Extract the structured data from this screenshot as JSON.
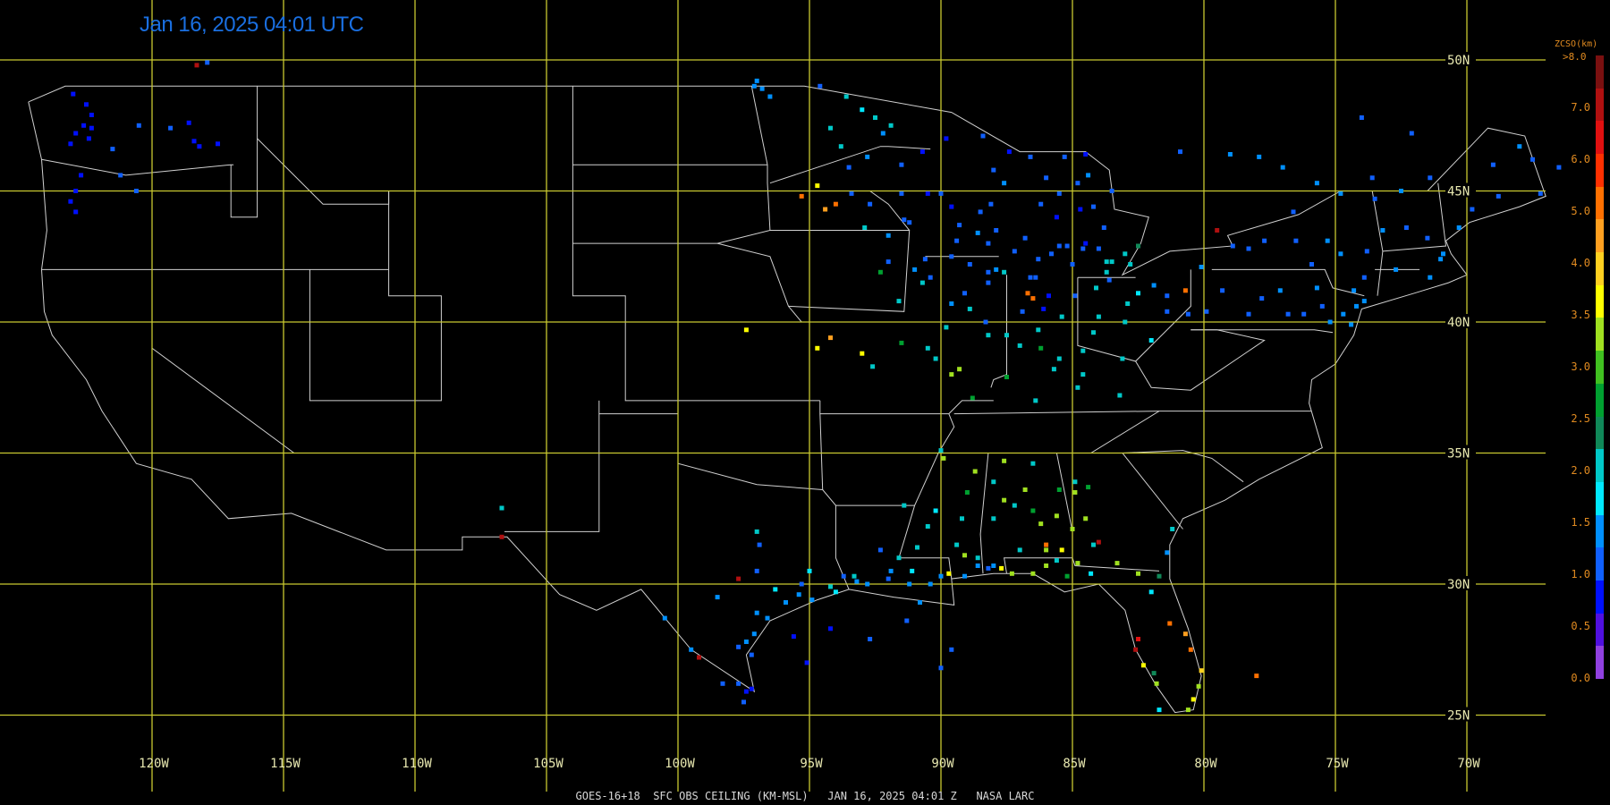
{
  "header": {
    "timestamp": "Jan 16, 2025 04:01 UTC"
  },
  "footer": {
    "caption": "GOES-16+18  SFC OBS CEILING (KM-MSL)   JAN 16, 2025 04:01 Z   NASA LARC"
  },
  "map": {
    "projection": "equirectangular",
    "lon_range": [
      -125,
      -66
    ],
    "lat_range": [
      23.5,
      52
    ],
    "lon_lines": [
      -120,
      -115,
      -110,
      -105,
      -100,
      -95,
      -90,
      -85,
      -80,
      -75,
      -70
    ],
    "lon_labels": [
      "120W",
      "115W",
      "110W",
      "105W",
      "100W",
      "95W",
      "90W",
      "85W",
      "80W",
      "75W",
      "70W"
    ],
    "lat_lines": [
      50,
      45,
      40,
      35,
      30,
      25
    ],
    "lat_labels": [
      "50N",
      "45N",
      "40N",
      "35N",
      "30N",
      "25N"
    ],
    "grid_color": "#c8c830",
    "boundary_color": "#d0d0d0"
  },
  "legend": {
    "title": "ZCSO(km)",
    "max_label": ">8.0",
    "ticks": [
      "7.0",
      "6.0",
      "5.0",
      "4.0",
      "3.5",
      "3.0",
      "2.5",
      "2.0",
      "1.5",
      "1.0",
      "0.5",
      "0.0"
    ],
    "colors": [
      "#7a1010",
      "#b01010",
      "#e01010",
      "#ff3000",
      "#ff7000",
      "#ffa020",
      "#ffd020",
      "#ffff00",
      "#a0e020",
      "#40c020",
      "#00a030",
      "#108858",
      "#00c8c8",
      "#00e8ff",
      "#0090ff",
      "#1060ff",
      "#0010ff",
      "#5010e0",
      "#9040e0"
    ]
  },
  "stations": [
    [
      -123.0,
      48.7,
      0.5
    ],
    [
      -122.5,
      48.3,
      0.5
    ],
    [
      -122.3,
      47.9,
      0.5
    ],
    [
      -122.6,
      47.5,
      0.5
    ],
    [
      -122.9,
      47.2,
      0.5
    ],
    [
      -122.4,
      47.0,
      0.5
    ],
    [
      -122.3,
      47.4,
      0.5
    ],
    [
      -123.1,
      46.8,
      0.5
    ],
    [
      -122.7,
      45.6,
      0.5
    ],
    [
      -122.9,
      45.0,
      0.5
    ],
    [
      -123.1,
      44.6,
      0.5
    ],
    [
      -122.9,
      44.2,
      0.5
    ],
    [
      -121.5,
      46.6,
      1.0
    ],
    [
      -120.5,
      47.5,
      1.2
    ],
    [
      -119.3,
      47.4,
      1.2
    ],
    [
      -118.6,
      47.6,
      0.5
    ],
    [
      -118.4,
      46.9,
      0.5
    ],
    [
      -117.5,
      46.8,
      0.5
    ],
    [
      -118.2,
      46.7,
      0.5
    ],
    [
      -121.2,
      45.6,
      1.2
    ],
    [
      -120.6,
      45.0,
      1.0
    ],
    [
      -117.9,
      49.9,
      1.2
    ],
    [
      -118.3,
      49.8,
      7.2
    ],
    [
      -97.1,
      49.0,
      1.8
    ],
    [
      -96.8,
      48.9,
      1.8
    ],
    [
      -96.5,
      48.6,
      1.8
    ],
    [
      -97.0,
      49.2,
      1.8
    ],
    [
      -94.6,
      49.0,
      1.2
    ],
    [
      -93.6,
      48.6,
      2.5
    ],
    [
      -93.0,
      48.1,
      2.2
    ],
    [
      -92.5,
      47.8,
      2.5
    ],
    [
      -91.9,
      47.5,
      2.7
    ],
    [
      -92.2,
      47.2,
      1.5
    ],
    [
      -94.2,
      47.4,
      2.5
    ],
    [
      -93.8,
      46.7,
      2.5
    ],
    [
      -92.8,
      46.3,
      1.5
    ],
    [
      -93.5,
      45.9,
      1.0
    ],
    [
      -94.7,
      45.2,
      4.0
    ],
    [
      -95.3,
      44.8,
      5.5
    ],
    [
      -94.4,
      44.3,
      5.0
    ],
    [
      -94.0,
      44.5,
      5.5
    ],
    [
      -93.4,
      44.9,
      1.0
    ],
    [
      -92.7,
      44.5,
      1.0
    ],
    [
      -91.5,
      46.0,
      1.0
    ],
    [
      -90.7,
      46.5,
      0.8
    ],
    [
      -89.8,
      47.0,
      0.8
    ],
    [
      -88.4,
      47.1,
      1.0
    ],
    [
      -87.4,
      46.5,
      0.8
    ],
    [
      -86.6,
      46.3,
      1.0
    ],
    [
      -85.3,
      46.3,
      1.0
    ],
    [
      -84.5,
      46.4,
      0.8
    ],
    [
      -84.4,
      45.6,
      1.5
    ],
    [
      -83.5,
      45.0,
      1.0
    ],
    [
      -84.8,
      45.3,
      1.0
    ],
    [
      -85.5,
      44.9,
      1.0
    ],
    [
      -86.2,
      44.5,
      1.2
    ],
    [
      -85.6,
      44.0,
      0.8
    ],
    [
      -84.7,
      44.3,
      0.8
    ],
    [
      -83.8,
      43.6,
      1.0
    ],
    [
      -84.5,
      43.0,
      0.8
    ],
    [
      -85.5,
      42.9,
      1.2
    ],
    [
      -86.3,
      42.4,
      1.0
    ],
    [
      -85.0,
      42.2,
      1.0
    ],
    [
      -83.5,
      42.3,
      2.5
    ],
    [
      -83.0,
      42.6,
      2.7
    ],
    [
      -82.5,
      42.9,
      2.8
    ],
    [
      -83.7,
      41.9,
      2.5
    ],
    [
      -84.1,
      41.3,
      2.5
    ],
    [
      -84.9,
      41.0,
      1.2
    ],
    [
      -85.9,
      41.0,
      0.8
    ],
    [
      -86.6,
      41.7,
      1.0
    ],
    [
      -87.6,
      41.9,
      2.5
    ],
    [
      -88.2,
      41.5,
      1.2
    ],
    [
      -88.9,
      42.2,
      1.2
    ],
    [
      -89.6,
      42.5,
      1.2
    ],
    [
      -89.4,
      43.1,
      1.0
    ],
    [
      -88.2,
      43.0,
      1.0
    ],
    [
      -87.9,
      43.5,
      1.2
    ],
    [
      -88.5,
      44.2,
      1.0
    ],
    [
      -89.6,
      44.4,
      0.8
    ],
    [
      -90.5,
      44.9,
      0.8
    ],
    [
      -91.5,
      44.9,
      1.0
    ],
    [
      -91.4,
      43.9,
      1.2
    ],
    [
      -92.0,
      43.3,
      1.5
    ],
    [
      -92.9,
      43.6,
      2.5
    ],
    [
      -90.6,
      42.4,
      1.0
    ],
    [
      -90.4,
      41.7,
      1.2
    ],
    [
      -91.0,
      42.0,
      1.5
    ],
    [
      -92.3,
      41.9,
      3.0
    ],
    [
      -91.6,
      40.8,
      2.5
    ],
    [
      -90.7,
      41.5,
      2.5
    ],
    [
      -89.6,
      40.7,
      1.5
    ],
    [
      -88.9,
      40.5,
      2.5
    ],
    [
      -88.3,
      40.0,
      1.2
    ],
    [
      -87.5,
      39.5,
      2.5
    ],
    [
      -86.3,
      39.7,
      2.5
    ],
    [
      -85.4,
      40.2,
      2.5
    ],
    [
      -86.1,
      40.5,
      0.8
    ],
    [
      -86.9,
      40.4,
      1.2
    ],
    [
      -87.0,
      39.1,
      2.5
    ],
    [
      -86.2,
      39.0,
      3.0
    ],
    [
      -85.5,
      38.6,
      2.5
    ],
    [
      -84.6,
      38.9,
      2.5
    ],
    [
      -84.2,
      39.6,
      2.7
    ],
    [
      -84.0,
      40.2,
      2.5
    ],
    [
      -83.0,
      40.0,
      2.5
    ],
    [
      -82.9,
      40.7,
      2.5
    ],
    [
      -82.5,
      41.1,
      2.0
    ],
    [
      -81.4,
      41.0,
      1.2
    ],
    [
      -81.9,
      41.4,
      1.5
    ],
    [
      -80.7,
      41.2,
      5.8
    ],
    [
      -81.4,
      40.4,
      1.2
    ],
    [
      -80.6,
      40.3,
      1.2
    ],
    [
      -82.0,
      39.3,
      2.0
    ],
    [
      -83.1,
      38.6,
      2.5
    ],
    [
      -84.6,
      38.0,
      2.5
    ],
    [
      -85.7,
      38.2,
      2.5
    ],
    [
      -84.8,
      37.5,
      2.5
    ],
    [
      -83.2,
      37.2,
      2.5
    ],
    [
      -86.4,
      37.0,
      2.5
    ],
    [
      -87.5,
      37.9,
      3.0
    ],
    [
      -88.8,
      37.1,
      3.0
    ],
    [
      -89.6,
      38.0,
      3.5
    ],
    [
      -86.7,
      41.1,
      5.5
    ],
    [
      -86.5,
      40.9,
      5.7
    ],
    [
      -84.0,
      42.8,
      1.2
    ],
    [
      -84.2,
      44.4,
      1.0
    ],
    [
      -86.0,
      45.5,
      1.0
    ],
    [
      -88.1,
      44.5,
      1.0
    ],
    [
      -87.6,
      45.3,
      1.5
    ],
    [
      -88.0,
      45.8,
      1.0
    ],
    [
      -79.5,
      43.5,
      7.5
    ],
    [
      -78.9,
      42.9,
      1.0
    ],
    [
      -78.3,
      42.8,
      1.2
    ],
    [
      -77.7,
      43.1,
      1.2
    ],
    [
      -76.5,
      43.1,
      1.2
    ],
    [
      -75.9,
      42.2,
      1.2
    ],
    [
      -75.3,
      43.1,
      1.5
    ],
    [
      -74.8,
      42.6,
      1.5
    ],
    [
      -73.8,
      42.7,
      1.2
    ],
    [
      -73.2,
      43.5,
      1.5
    ],
    [
      -73.9,
      41.7,
      1.2
    ],
    [
      -74.3,
      41.2,
      1.5
    ],
    [
      -73.9,
      40.8,
      1.8
    ],
    [
      -74.2,
      40.6,
      1.8
    ],
    [
      -74.7,
      40.3,
      1.8
    ],
    [
      -74.4,
      39.9,
      1.8
    ],
    [
      -75.2,
      40.0,
      1.8
    ],
    [
      -75.5,
      40.6,
      1.2
    ],
    [
      -76.2,
      40.3,
      1.2
    ],
    [
      -76.8,
      40.3,
      1.2
    ],
    [
      -77.8,
      40.9,
      1.2
    ],
    [
      -78.3,
      40.3,
      1.2
    ],
    [
      -79.9,
      40.4,
      1.2
    ],
    [
      -79.3,
      41.2,
      1.2
    ],
    [
      -80.1,
      42.1,
      1.5
    ],
    [
      -77.1,
      41.2,
      1.5
    ],
    [
      -75.7,
      41.3,
      1.5
    ],
    [
      -72.7,
      42.0,
      1.8
    ],
    [
      -71.4,
      41.7,
      1.8
    ],
    [
      -71.0,
      42.4,
      1.5
    ],
    [
      -70.9,
      42.6,
      1.8
    ],
    [
      -71.5,
      43.2,
      1.2
    ],
    [
      -72.3,
      43.6,
      1.2
    ],
    [
      -70.3,
      43.6,
      1.5
    ],
    [
      -69.8,
      44.3,
      1.2
    ],
    [
      -68.8,
      44.8,
      1.2
    ],
    [
      -68.0,
      46.7,
      1.5
    ],
    [
      -69.0,
      46.0,
      1.2
    ],
    [
      -71.4,
      45.5,
      1.2
    ],
    [
      -72.5,
      45.0,
      1.8
    ],
    [
      -73.5,
      44.7,
      1.2
    ],
    [
      -74.8,
      44.9,
      1.5
    ],
    [
      -76.6,
      44.2,
      1.2
    ],
    [
      -77.0,
      45.9,
      1.5
    ],
    [
      -79.0,
      46.4,
      1.5
    ],
    [
      -77.9,
      46.3,
      1.5
    ],
    [
      -75.7,
      45.3,
      1.5
    ],
    [
      -73.6,
      45.5,
      1.2
    ],
    [
      -72.1,
      47.2,
      1.2
    ],
    [
      -80.9,
      46.5,
      1.2
    ],
    [
      -74.0,
      47.8,
      1.2
    ],
    [
      -66.5,
      45.9,
      1.2
    ],
    [
      -67.5,
      46.2,
      1.2
    ],
    [
      -67.2,
      44.9,
      1.2
    ],
    [
      -92.0,
      42.3,
      1.2
    ],
    [
      -87.2,
      42.7,
      1.2
    ],
    [
      -87.9,
      42.0,
      1.5
    ],
    [
      -88.6,
      43.4,
      1.8
    ],
    [
      -89.3,
      43.7,
      1.2
    ],
    [
      -90.0,
      44.9,
      1.2
    ],
    [
      -91.2,
      43.8,
      1.2
    ],
    [
      -89.1,
      41.1,
      1.2
    ],
    [
      -88.2,
      41.9,
      1.2
    ],
    [
      -86.4,
      41.7,
      1.0
    ],
    [
      -85.8,
      42.6,
      1.2
    ],
    [
      -85.2,
      42.9,
      1.2
    ],
    [
      -83.7,
      42.3,
      2.7
    ],
    [
      -82.8,
      42.2,
      2.5
    ],
    [
      -83.6,
      41.6,
      1.2
    ],
    [
      -84.6,
      42.8,
      1.0
    ],
    [
      -86.8,
      43.2,
      1.0
    ],
    [
      -89.2,
      32.5,
      2.5
    ],
    [
      -88.6,
      31.0,
      2.5
    ],
    [
      -89.4,
      31.5,
      2.7
    ],
    [
      -90.5,
      32.2,
      2.5
    ],
    [
      -90.9,
      31.4,
      2.5
    ],
    [
      -90.2,
      32.8,
      2.0
    ],
    [
      -91.1,
      30.5,
      2.0
    ],
    [
      -91.6,
      31.0,
      2.5
    ],
    [
      -92.3,
      31.3,
      1.2
    ],
    [
      -92.0,
      30.2,
      1.2
    ],
    [
      -93.2,
      30.1,
      1.5
    ],
    [
      -93.7,
      30.3,
      1.2
    ],
    [
      -94.2,
      29.9,
      2.5
    ],
    [
      -94.9,
      29.4,
      1.8
    ],
    [
      -95.4,
      29.6,
      1.8
    ],
    [
      -95.3,
      30.0,
      1.2
    ],
    [
      -95.9,
      29.3,
      1.8
    ],
    [
      -96.6,
      28.7,
      1.8
    ],
    [
      -97.1,
      28.1,
      1.8
    ],
    [
      -97.4,
      27.8,
      1.8
    ],
    [
      -97.7,
      27.6,
      1.2
    ],
    [
      -97.2,
      27.3,
      1.2
    ],
    [
      -97.7,
      26.2,
      1.2
    ],
    [
      -97.2,
      26.0,
      0.8
    ],
    [
      -97.4,
      25.9,
      0.5
    ],
    [
      -98.3,
      26.2,
      1.2
    ],
    [
      -99.5,
      27.5,
      1.8
    ],
    [
      -98.5,
      29.5,
      1.8
    ],
    [
      -97.0,
      28.9,
      1.8
    ],
    [
      -96.3,
      29.8,
      2.2
    ],
    [
      -97.7,
      30.2,
      7.2
    ],
    [
      -96.9,
      31.5,
      1.2
    ],
    [
      -95.0,
      30.5,
      2.2
    ],
    [
      -94.0,
      29.7,
      2.2
    ],
    [
      -93.3,
      30.3,
      2.7
    ],
    [
      -92.8,
      30.0,
      1.5
    ],
    [
      -91.9,
      30.5,
      1.8
    ],
    [
      -91.2,
      30.0,
      1.5
    ],
    [
      -90.4,
      30.0,
      1.8
    ],
    [
      -90.0,
      30.3,
      1.8
    ],
    [
      -89.7,
      30.4,
      4.0
    ],
    [
      -89.1,
      30.3,
      1.8
    ],
    [
      -88.6,
      30.7,
      1.8
    ],
    [
      -88.2,
      30.6,
      1.2
    ],
    [
      -87.7,
      30.6,
      4.0
    ],
    [
      -87.3,
      30.4,
      3.5
    ],
    [
      -86.5,
      30.4,
      3.5
    ],
    [
      -86.0,
      30.7,
      3.5
    ],
    [
      -85.6,
      30.9,
      2.5
    ],
    [
      -85.2,
      30.3,
      3.0
    ],
    [
      -84.3,
      30.4,
      2.0
    ],
    [
      -83.3,
      30.8,
      3.5
    ],
    [
      -82.5,
      30.4,
      3.5
    ],
    [
      -81.7,
      30.3,
      2.8
    ],
    [
      -81.4,
      31.2,
      1.5
    ],
    [
      -81.2,
      32.1,
      2.5
    ],
    [
      -84.0,
      31.6,
      7.5
    ],
    [
      -84.5,
      32.5,
      3.5
    ],
    [
      -84.9,
      33.5,
      3.5
    ],
    [
      -84.4,
      33.7,
      3.0
    ],
    [
      -85.0,
      32.1,
      3.5
    ],
    [
      -85.6,
      32.6,
      3.8
    ],
    [
      -86.2,
      32.3,
      3.5
    ],
    [
      -86.8,
      33.6,
      3.5
    ],
    [
      -87.2,
      33.0,
      2.5
    ],
    [
      -87.6,
      33.2,
      3.5
    ],
    [
      -88.0,
      33.9,
      2.5
    ],
    [
      -86.5,
      34.6,
      2.5
    ],
    [
      -87.6,
      34.7,
      3.5
    ],
    [
      -88.7,
      34.3,
      3.5
    ],
    [
      -89.9,
      34.8,
      3.5
    ],
    [
      -90.0,
      35.1,
      2.5
    ],
    [
      -89.0,
      33.5,
      3.0
    ],
    [
      -88.0,
      32.5,
      2.5
    ],
    [
      -87.0,
      31.3,
      2.5
    ],
    [
      -86.0,
      31.3,
      3.5
    ],
    [
      -85.4,
      31.3,
      4.0
    ],
    [
      -84.8,
      30.8,
      3.5
    ],
    [
      -84.2,
      31.5,
      2.5
    ],
    [
      -84.9,
      33.9,
      2.5
    ],
    [
      -85.5,
      33.6,
      3.0
    ],
    [
      -86.0,
      31.5,
      5.5
    ],
    [
      -86.5,
      32.8,
      3.0
    ],
    [
      -88.0,
      30.7,
      1.5
    ],
    [
      -89.1,
      31.1,
      3.5
    ],
    [
      -91.4,
      33.0,
      2.5
    ],
    [
      -90.8,
      29.3,
      1.5
    ],
    [
      -91.3,
      28.6,
      1.2
    ],
    [
      -92.7,
      27.9,
      1.2
    ],
    [
      -89.6,
      27.5,
      1.0
    ],
    [
      -95.6,
      28.0,
      0.5
    ],
    [
      -95.1,
      27.0,
      0.5
    ],
    [
      -94.2,
      28.3,
      0.5
    ],
    [
      -90.0,
      26.8,
      1.0
    ],
    [
      -82.5,
      27.9,
      6.5
    ],
    [
      -82.6,
      27.5,
      7.5
    ],
    [
      -81.9,
      26.6,
      2.8
    ],
    [
      -80.7,
      28.1,
      5.0
    ],
    [
      -80.5,
      27.5,
      5.5
    ],
    [
      -80.1,
      26.7,
      4.5
    ],
    [
      -80.2,
      26.1,
      3.8
    ],
    [
      -80.4,
      25.6,
      4.0
    ],
    [
      -80.6,
      25.2,
      3.8
    ],
    [
      -81.8,
      26.2,
      3.5
    ],
    [
      -82.3,
      26.9,
      4.0
    ],
    [
      -81.3,
      28.5,
      5.5
    ],
    [
      -82.0,
      29.7,
      2.0
    ],
    [
      -81.7,
      25.2,
      2.0
    ],
    [
      -78.0,
      26.5,
      5.5
    ],
    [
      -94.2,
      39.4,
      5.0
    ],
    [
      -94.7,
      39.0,
      4.0
    ],
    [
      -93.0,
      38.8,
      4.0
    ],
    [
      -92.6,
      38.3,
      2.7
    ],
    [
      -91.5,
      39.2,
      3.0
    ],
    [
      -97.4,
      39.7,
      4.0
    ],
    [
      -90.2,
      38.6,
      2.5
    ],
    [
      -89.8,
      39.8,
      2.5
    ],
    [
      -90.5,
      39.0,
      2.5
    ],
    [
      -89.3,
      38.2,
      3.5
    ],
    [
      -88.2,
      39.5,
      2.5
    ],
    [
      -106.7,
      32.9,
      2.5
    ],
    [
      -106.7,
      31.8,
      7.5
    ],
    [
      -99.2,
      27.2,
      7.5
    ],
    [
      -97.0,
      30.5,
      1.2
    ],
    [
      -97.5,
      25.5,
      1.2
    ],
    [
      -100.5,
      28.7,
      1.8
    ],
    [
      -97.0,
      32.0,
      2.5
    ]
  ]
}
